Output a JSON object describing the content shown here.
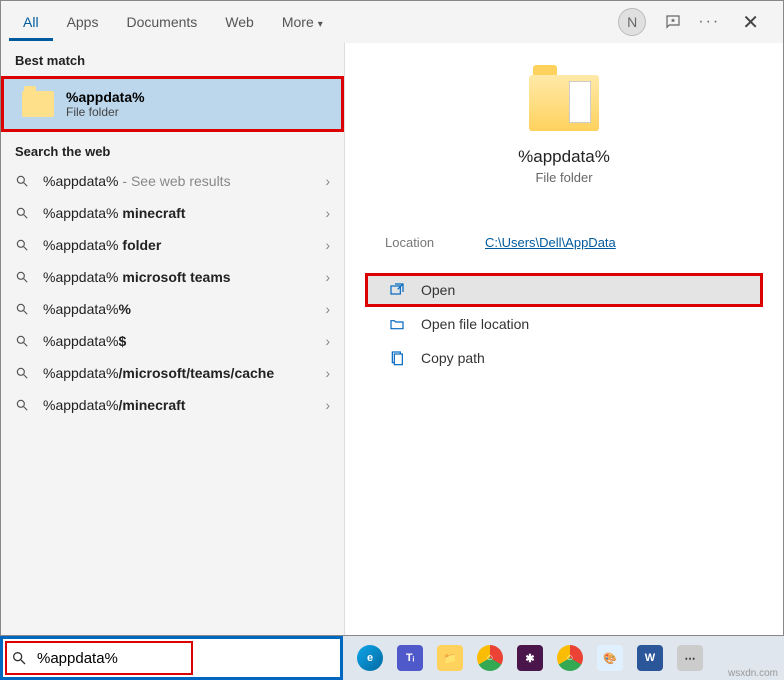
{
  "tabs": {
    "all": "All",
    "apps": "Apps",
    "documents": "Documents",
    "web": "Web",
    "more": "More"
  },
  "header": {
    "avatar_initial": "N"
  },
  "sections": {
    "best_match": "Best match",
    "search_web": "Search the web"
  },
  "best_match": {
    "title": "%appdata%",
    "subtitle": "File folder"
  },
  "suggestions": [
    {
      "name": "%appdata%",
      "suffix": " - See web results",
      "bold_suffix": ""
    },
    {
      "name": "%appdata%",
      "bold_suffix": " minecraft",
      "suffix": ""
    },
    {
      "name": "%appdata%",
      "bold_suffix": " folder",
      "suffix": ""
    },
    {
      "name": "%appdata%",
      "bold_suffix": " microsoft teams",
      "suffix": ""
    },
    {
      "name": "%appdata%",
      "bold_suffix": "%",
      "suffix": ""
    },
    {
      "name": "%appdata%",
      "bold_suffix": "$",
      "suffix": ""
    },
    {
      "name": "%appdata%",
      "bold_suffix": "/microsoft/teams/cache",
      "suffix": ""
    },
    {
      "name": "%appdata%",
      "bold_suffix": "/minecraft",
      "suffix": ""
    }
  ],
  "preview": {
    "title": "%appdata%",
    "subtitle": "File folder",
    "location_label": "Location",
    "location_value": "C:\\Users\\Dell\\AppData"
  },
  "actions": {
    "open": "Open",
    "open_file_location": "Open file location",
    "copy_path": "Copy path"
  },
  "search": {
    "value": "%appdata%"
  },
  "watermark": "wsxdn.com"
}
